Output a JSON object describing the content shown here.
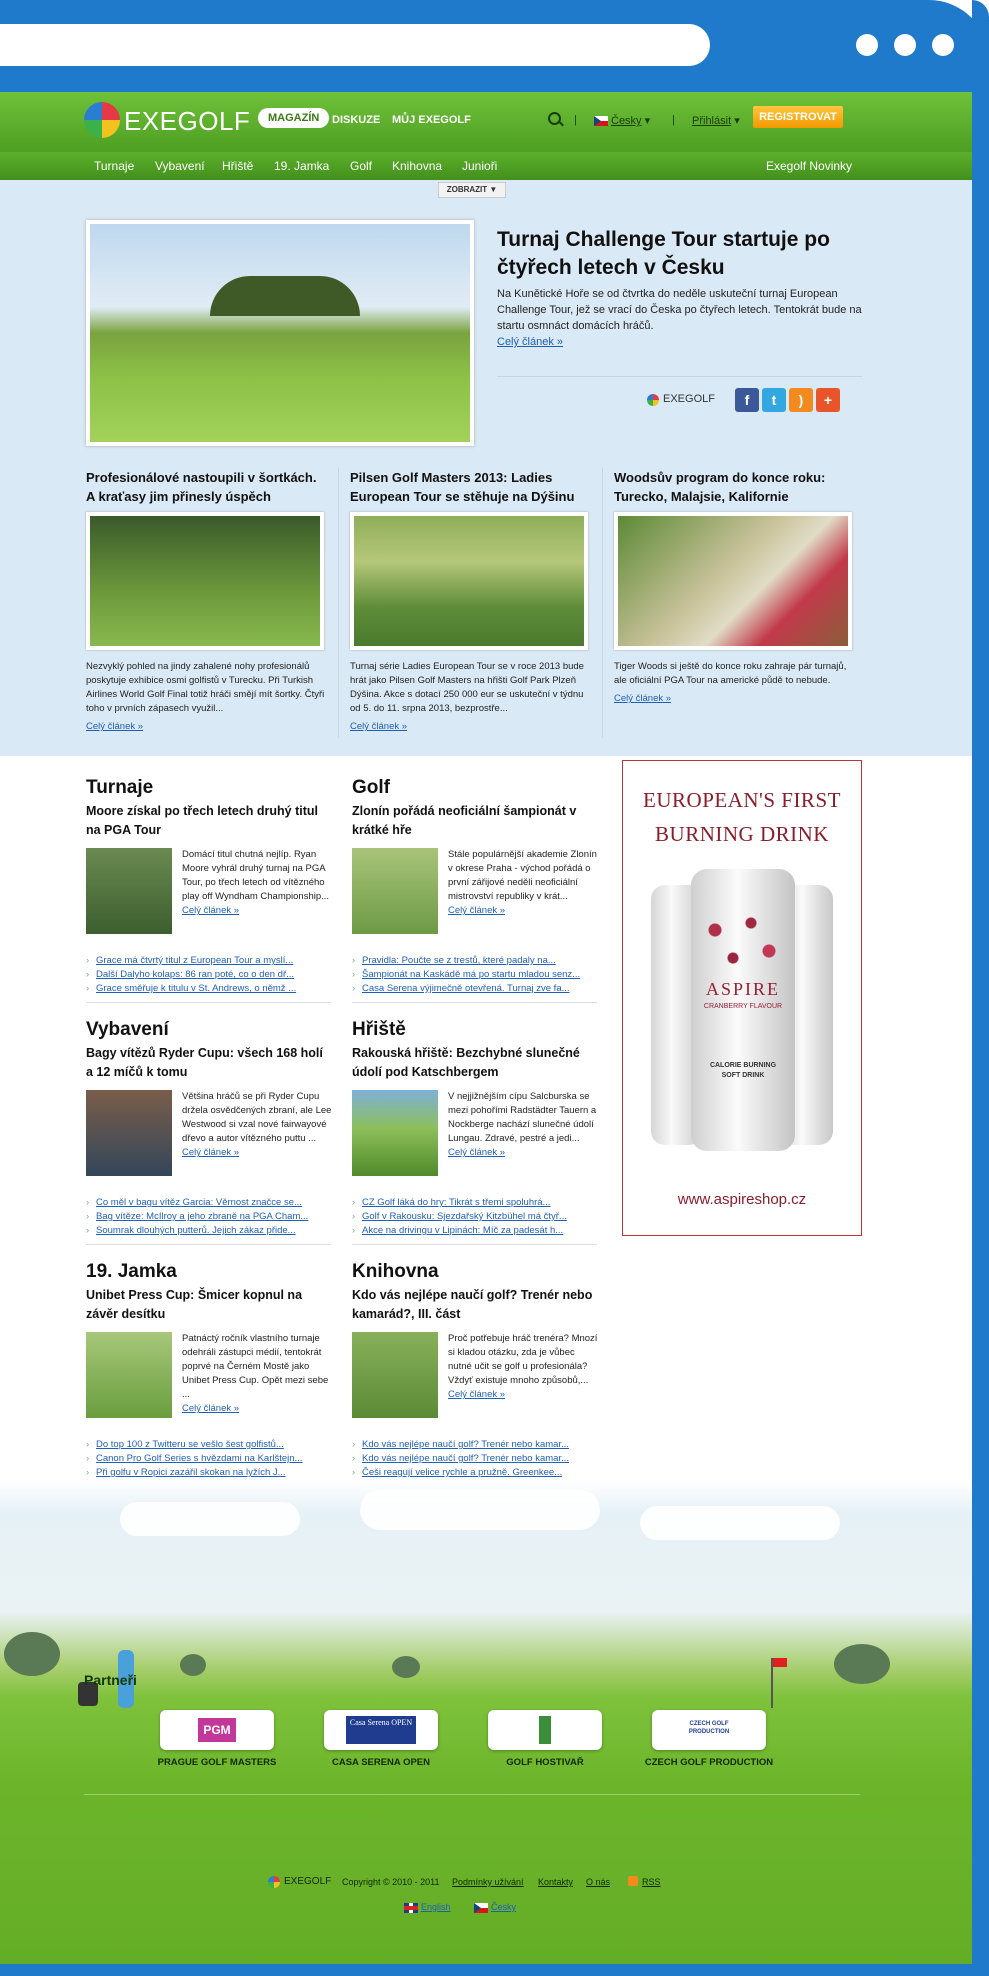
{
  "header": {
    "logo": "EXEGOLF",
    "nav": [
      "MAGAZÍN",
      "DISKUZE",
      "MŮJ EXEGOLF"
    ],
    "language": "Česky",
    "login": "Přihlásit",
    "register": "REGISTROVAT"
  },
  "subnav": {
    "items": [
      "Turnaje",
      "Vybavení",
      "Hřiště",
      "19. Jamka",
      "Golf",
      "Knihovna",
      "Junioři"
    ],
    "right": "Exegolf Novinky",
    "toggle": "ZOBRAZIT"
  },
  "hero": {
    "title": "Turnaj Challenge Tour startuje po čtyřech letech v Česku",
    "text": "Na Kunětické Hoře se od čtvrtka do neděle uskuteční turnaj European Challenge Tour, jež se vrací do Česka po čtyřech letech. Tentokrát bude na startu osmnáct domácích hráčů.",
    "more": "Celý článek »",
    "share_brand": "EXEGOLF"
  },
  "featured": [
    {
      "title": "Profesionálové nastoupili v šortkách. A kraťasy jim přinesly úspěch",
      "text": "Nezvyklý pohled na jindy zahalené nohy profesionálů poskytuje exhibice osmi golfistů v Turecku. Při Turkish Airlines World Golf Final totiž hráči smějí mít šortky. Čtyři toho v prvních zápasech využil...",
      "more": "Celý článek »"
    },
    {
      "title": "Pilsen Golf Masters 2013: Ladies European Tour se stěhuje na Dýšinu",
      "text": "Turnaj série Ladies European Tour se v roce 2013 bude hrát jako Pilsen Golf Masters na hřišti Golf Park Plzeň Dýšina. Akce s dotací 250 000 eur se uskuteční v týdnu od 5. do 11. srpna 2013, bezprostře...",
      "more": "Celý článek »"
    },
    {
      "title": "Woodsův program do konce roku: Turecko, Malajsie, Kalifornie",
      "text": "Tiger Woods si ještě do konce roku zahraje pár turnajů, ale oficiální PGA Tour na americké půdě to nebude.",
      "more": "Celý článek »"
    }
  ],
  "sections": [
    {
      "heading": "Turnaje",
      "title": "Moore získal po třech letech druhý titul na PGA Tour",
      "text": "Domácí titul chutná nejlíp. Ryan Moore vyhrál druhý turnaj na PGA Tour, po třech letech od vítězného play off Wyndham Championship...",
      "more": "Celý článek »",
      "links": [
        "Grace má čtvrtý titul z European Tour a myslí...",
        "Další Dalyho kolaps: 86 ran poté, co o den dř...",
        "Grace směřuje k titulu v St. Andrews, o němž ..."
      ]
    },
    {
      "heading": "Golf",
      "title": "Zlonín pořádá neoficiální šampionát v krátké hře",
      "text": "Stále populárnější akademie Zlonín v okrese Praha - východ pořádá o první zářijové neděli neoficiální mistrovství republiky v krát...",
      "more": "Celý článek »",
      "links": [
        "Pravidla: Poučte se z trestů, které padaly na...",
        "Šampionát na Kaskádě má po startu mladou senz...",
        "Casa Serena výjimečně otevřená. Turnaj zve fa..."
      ]
    },
    {
      "heading": "Vybavení",
      "title": "Bagy vítězů Ryder Cupu: všech 168 holí a 12 míčů k tomu",
      "text": "Většina hráčů se při Ryder Cupu držela osvědčených zbraní, ale Lee Westwood si vzal nové fairwayové dřevo a autor vítězného puttu ...",
      "more": "Celý článek »",
      "links": [
        "Co měl v bagu vítěz Garcia: Věrnost značce se...",
        "Bag vítěze: McIlroy a jeho zbraně na PGA Cham...",
        "Soumrak dlouhých putterů. Jejich zákaz přide..."
      ]
    },
    {
      "heading": "Hřiště",
      "title": "Rakouská hřiště: Bezchybné slunečné údolí pod Katschbergem",
      "text": "V nejjižnějším cípu Salcburska se mezi pohořími Radstädter Tauern a Nockberge nachází slunečné údolí Lungau. Zdravé, pestré a jedi...",
      "more": "Celý článek »",
      "links": [
        "CZ Golf láká do hry: Tikrát s třemi spoluhrá...",
        "Golf v Rakousku: Sjezdařský Kitzbühel má čtyř...",
        "Akce na drivingu v Lipinách: Míč za padesát h..."
      ]
    },
    {
      "heading": "19. Jamka",
      "title": "Unibet Press Cup: Šmicer kopnul na závěr desítku",
      "text": "Patnáctý ročník vlastního turnaje odehráli zástupci médií, tentokrát poprvé na Černém Mostě jako Unibet Press Cup. Opět mezi sebe ...",
      "more": "Celý článek »",
      "links": [
        "Do top 100 z Twitteru se vešlo šest golfistů...",
        "Canon Pro Golf Series s hvězdami na Karlštejn...",
        "Při golfu v Ropici zazářil skokan na lyžích J..."
      ]
    },
    {
      "heading": "Knihovna",
      "title": "Kdo vás nejlépe naučí golf? Trenér nebo kamarád?, III. část",
      "text": "Proč potřebuje hráč trenéra? Mnozí si kladou otázku, zda je vůbec nutné učit se golf u profesionála? Vždyť existuje mnoho způsobů,...",
      "more": "Celý článek »",
      "links": [
        "Kdo vás nejlépe naučí golf? Trenér nebo kamar...",
        "Kdo vás nejlépe naučí golf? Trenér nebo kamar...",
        "Češi reagují velice rychle a pružně. Greenkee..."
      ]
    }
  ],
  "ad": {
    "title_line1": "EUROPEAN'S FIRST",
    "title_line2": "BURNING DRINK",
    "brand": "ASPIRE",
    "flavour": "CRANBERRY FLAVOUR",
    "calorie_line1": "CALORIE BURNING",
    "calorie_line2": "SOFT DRINK",
    "url": "www.aspireshop.cz",
    "accent": "#8a1d2a"
  },
  "partners": {
    "heading": "Partneři",
    "items": [
      {
        "name": "PRAGUE GOLF MASTERS",
        "logo_text": "PGM"
      },
      {
        "name": "CASA SERENA OPEN",
        "logo_text": "Casa Serena OPEN"
      },
      {
        "name": "GOLF HOSTIVAŘ",
        "logo_text": ""
      },
      {
        "name": "CZECH GOLF PRODUCTION",
        "logo_text": "CZECH GOLF PRODUCTION"
      }
    ]
  },
  "footer": {
    "copyright": "Copyright © 2010 - 2011",
    "links": [
      "Podmínky užívání",
      "Kontakty",
      "O nás",
      "RSS"
    ],
    "languages": [
      "English",
      "Česky"
    ]
  },
  "colors": {
    "green": "#5cb02b",
    "orange": "#f29a00",
    "blue_frame": "#1f7acb",
    "hero_bg": "#d9e9f5"
  }
}
